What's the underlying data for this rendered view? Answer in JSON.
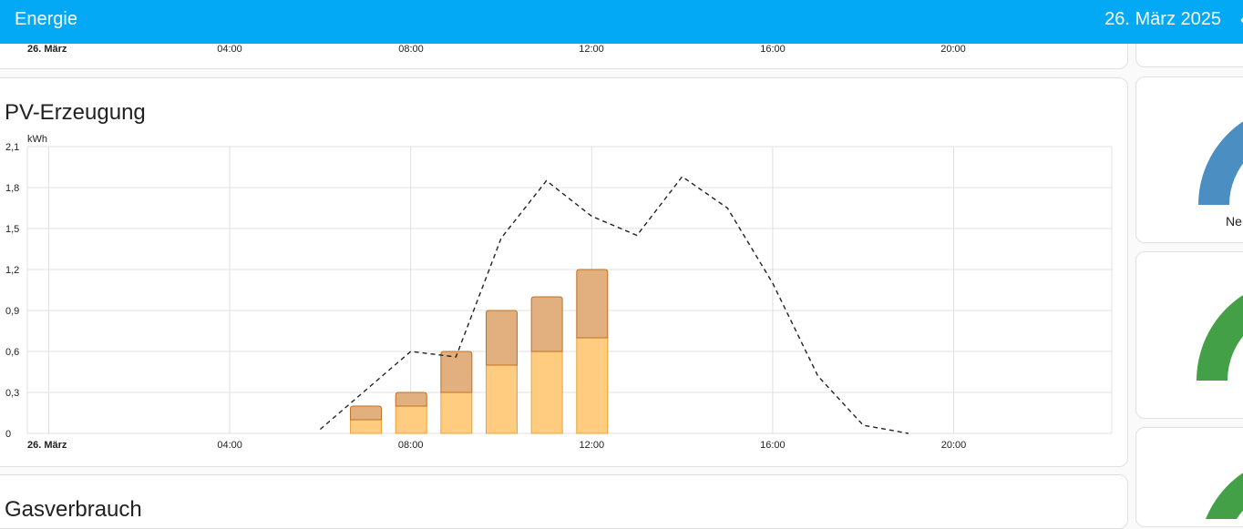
{
  "header": {
    "title": "Energie",
    "date": "26. März 2025",
    "back_icon": "‹"
  },
  "top_card": {
    "x_ticks": [
      "26. März",
      "04:00",
      "08:00",
      "12:00",
      "16:00",
      "20:00"
    ]
  },
  "pv_card": {
    "title": "PV-Erzeugung",
    "unit": "kWh"
  },
  "gas_card": {
    "title": "Gasverbrauch"
  },
  "side": {
    "gauge_label": "Ne",
    "colors": [
      "#4a8ec2",
      "#43a047",
      "#43a047"
    ]
  },
  "chart_data": {
    "type": "bar",
    "title": "PV-Erzeugung",
    "ylabel": "kWh",
    "ylim": [
      0,
      2.1
    ],
    "y_ticks": [
      "0",
      "0,3",
      "0,6",
      "0,9",
      "1,2",
      "1,5",
      "1,8",
      "2,1"
    ],
    "x_ticks": [
      "26. März",
      "04:00",
      "08:00",
      "12:00",
      "16:00",
      "20:00"
    ],
    "hours": [
      7,
      8,
      9,
      10,
      11,
      12
    ],
    "series": [
      {
        "values": [
          0.1,
          0.2,
          0.3,
          0.5,
          0.6,
          0.7
        ],
        "color": "#ffcc80",
        "stroke": "#f0a030"
      },
      {
        "values": [
          0.1,
          0.1,
          0.3,
          0.4,
          0.4,
          0.5
        ],
        "color": "#e2b07e",
        "stroke": "#c07020"
      }
    ],
    "forecast": {
      "hours": [
        6,
        8,
        9,
        10,
        11,
        12,
        13,
        14,
        15,
        16,
        17,
        18,
        19
      ],
      "values": [
        0.03,
        0.6,
        0.56,
        1.43,
        1.85,
        1.59,
        1.45,
        1.88,
        1.65,
        1.1,
        0.42,
        0.06,
        0.0
      ]
    },
    "grid": true
  }
}
